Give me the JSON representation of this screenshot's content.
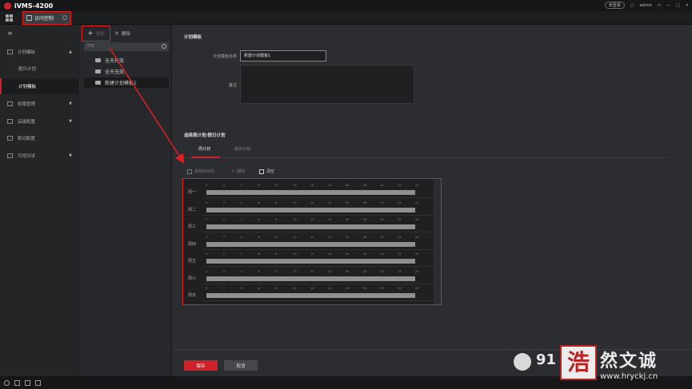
{
  "app": {
    "title": "iVMS-4200",
    "tab_label": "访问控制"
  },
  "titlebar": {
    "login_label": "未登录",
    "user_label": "admin"
  },
  "sidebar": {
    "items": [
      {
        "label": "计划模板",
        "expanded": true
      },
      {
        "label": "权限管理"
      },
      {
        "label": "高级配置"
      },
      {
        "label": "联动配置"
      },
      {
        "label": "可视对讲"
      }
    ],
    "sub_items": [
      {
        "label": "假日计划"
      },
      {
        "label": "计划模板",
        "active": true
      }
    ]
  },
  "template_panel": {
    "add_label": "添加",
    "delete_label": "删除",
    "search_placeholder": "搜索",
    "templates": [
      {
        "label": "全天有效"
      },
      {
        "label": "全天无效"
      },
      {
        "label": "新建计划模板1",
        "selected": true
      }
    ]
  },
  "main": {
    "section_title": "计划模板",
    "name_label": "计划模板名称",
    "name_value": "新建计划模板1",
    "remark_label": "备注",
    "schedule_section_title": "选择周计划/假日计划",
    "tabs": [
      {
        "label": "周计划",
        "active": true
      },
      {
        "label": "假日计划"
      }
    ],
    "actions": {
      "copy": "复制到本周",
      "delete": "删除",
      "clear": "清空"
    },
    "hours": [
      "0",
      "2",
      "4",
      "6",
      "8",
      "10",
      "12",
      "14",
      "16",
      "18",
      "20",
      "22",
      "24"
    ],
    "days": [
      "周一",
      "周二",
      "周三",
      "周四",
      "周五",
      "周六",
      "周日"
    ],
    "save_label": "保存",
    "cancel_label": "取消"
  },
  "watermark": {
    "number": "91",
    "stamp": "浩",
    "brand": "然文诚",
    "url": "www.hryckj.cn"
  },
  "colors": {
    "accent": "#d0212a",
    "annotation": "#e02020"
  }
}
